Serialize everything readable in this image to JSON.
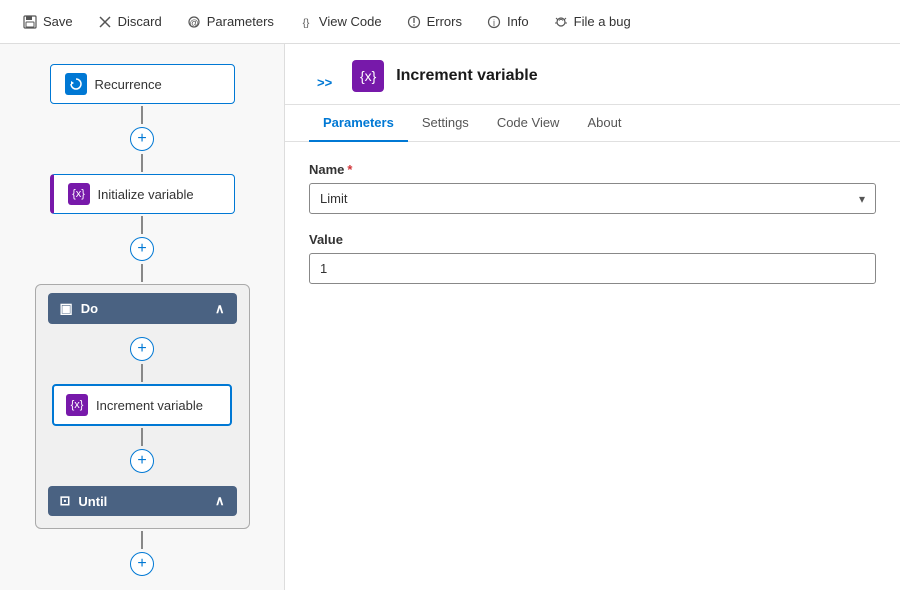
{
  "toolbar": {
    "save_label": "Save",
    "discard_label": "Discard",
    "parameters_label": "Parameters",
    "viewcode_label": "View Code",
    "errors_label": "Errors",
    "info_label": "Info",
    "fileabug_label": "File a bug"
  },
  "canvas": {
    "recurrence_label": "Recurrence",
    "init_variable_label": "Initialize variable",
    "do_label": "Do",
    "increment_variable_label": "Increment variable",
    "until_label": "Until"
  },
  "panel": {
    "title": "Increment variable",
    "expand_arrows": ">>",
    "tabs": [
      {
        "id": "parameters",
        "label": "Parameters",
        "active": true
      },
      {
        "id": "settings",
        "label": "Settings",
        "active": false
      },
      {
        "id": "codeview",
        "label": "Code View",
        "active": false
      },
      {
        "id": "about",
        "label": "About",
        "active": false
      }
    ],
    "form": {
      "name_label": "Name",
      "name_required": "*",
      "name_value": "Limit",
      "value_label": "Value",
      "value_value": "1"
    }
  }
}
